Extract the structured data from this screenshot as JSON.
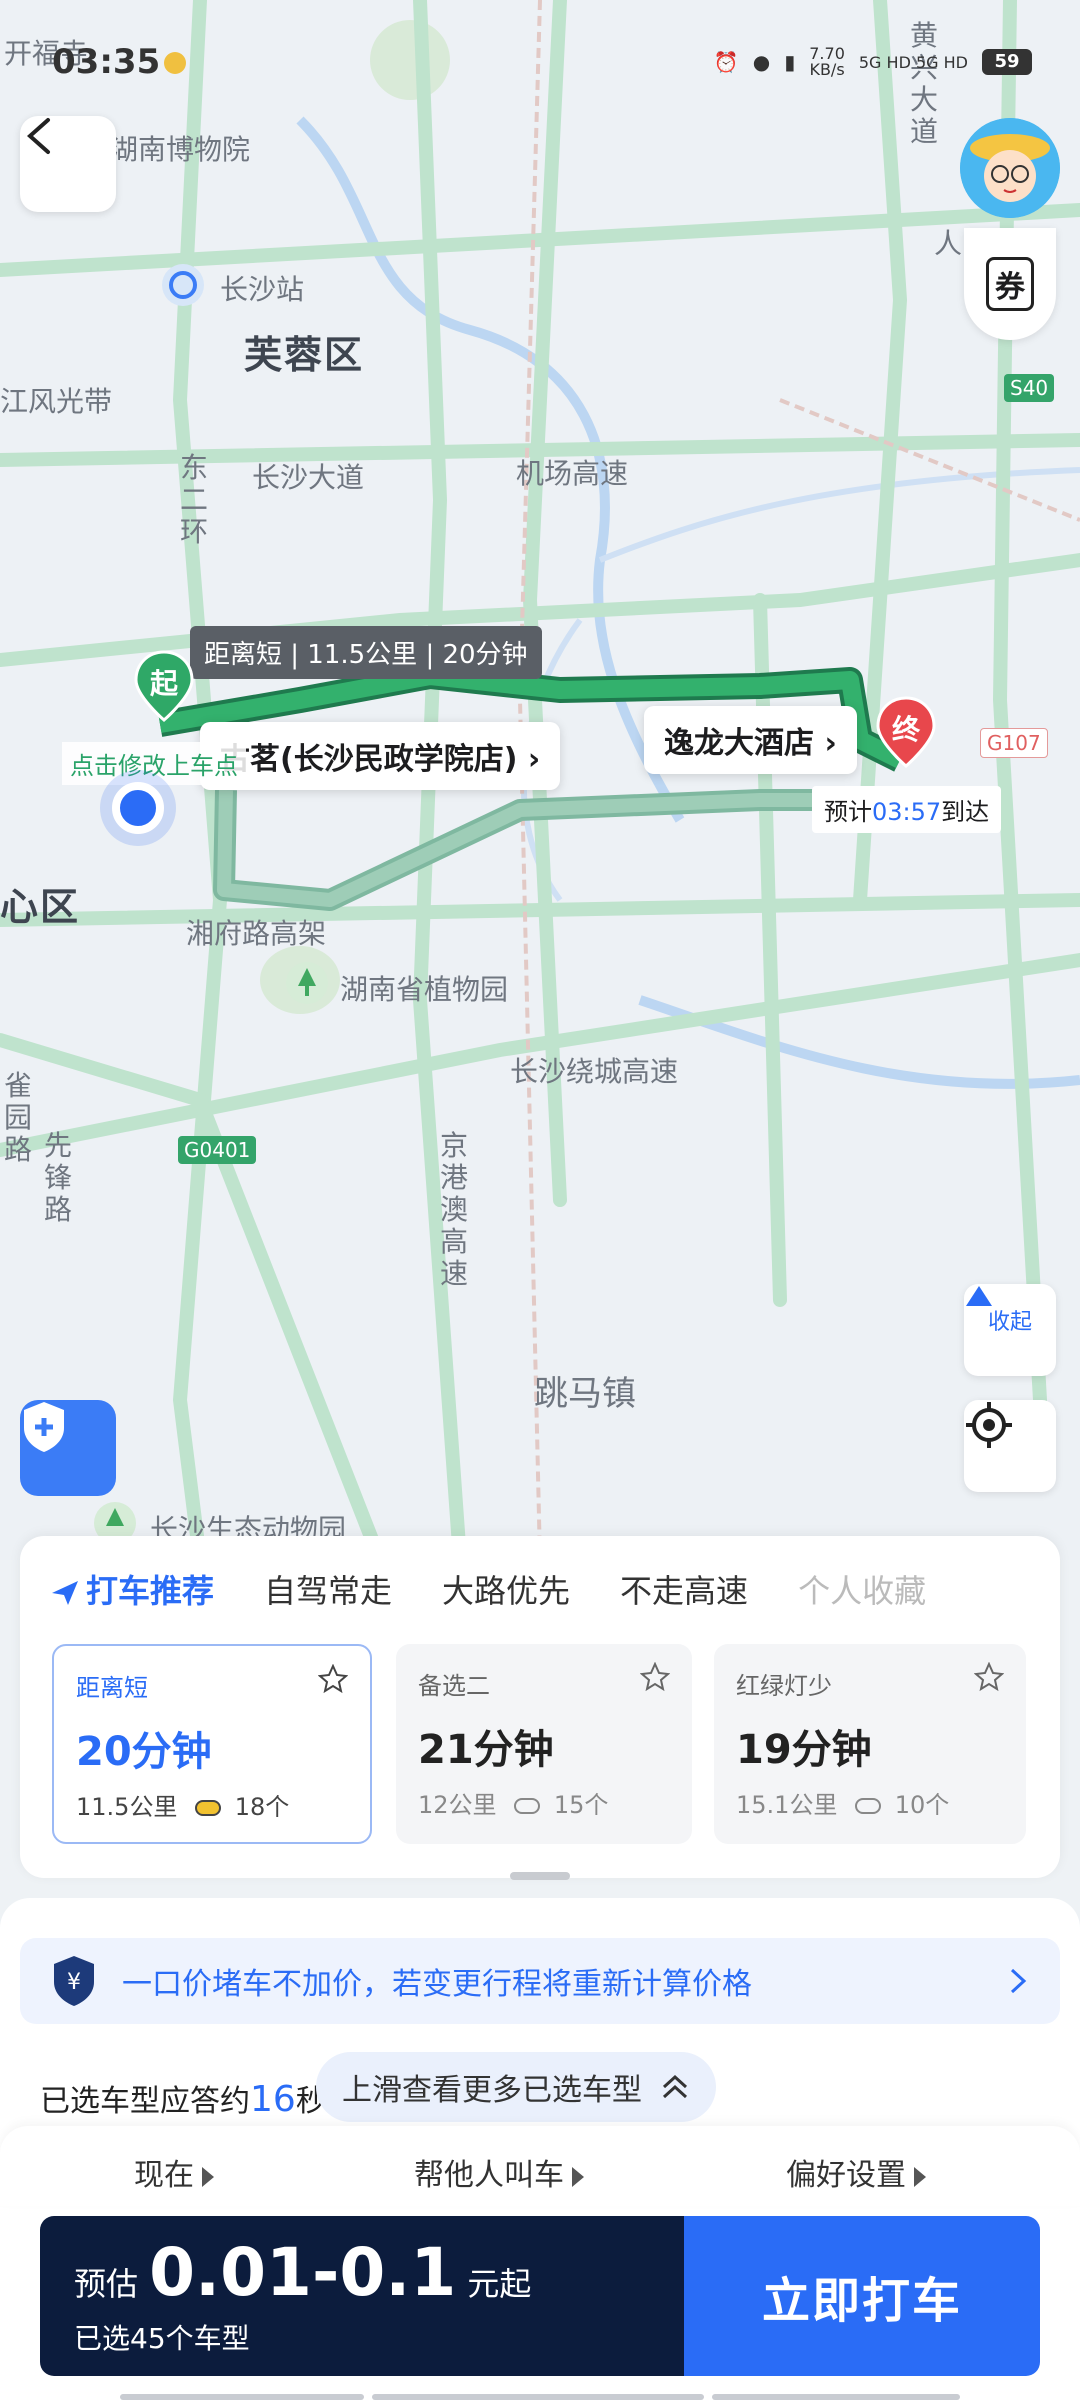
{
  "status_bar": {
    "time": "03:35",
    "net_speed": "7.70\nKB/s",
    "signal": "5G HD 5G HD",
    "battery": "59"
  },
  "map": {
    "labels": {
      "district_furong": "芙蓉区",
      "district_center": "心区",
      "station": "长沙站",
      "museum": "湖南博物院",
      "road_changsha_dadao": "长沙大道",
      "road_airport_hwy": "机场高速",
      "road_xiangfu": "湘府路高架",
      "road_ring": "长沙绕城高速",
      "road_jinggangao": "京港澳高速",
      "road_east2": "东二环",
      "road_queyuan": "雀园路",
      "road_xianfeng": "先锋路",
      "scenic": "江风光带",
      "botanic": "湖南省植物园",
      "town": "跳马镇",
      "zoo": "长沙生态动物园",
      "temple": "开福寺",
      "north": "黄兴大道",
      "north2": "人"
    },
    "shields": {
      "s40": "S40",
      "g107": "G107",
      "g0401": "G0401"
    },
    "route_tag": "距离短 | 11.5公里 | 20分钟",
    "start_pin": "起",
    "end_pin": "终",
    "start_place": "古茗(长沙民政学院店)",
    "end_place": "逸龙大酒店",
    "eta_prefix": "预计",
    "eta_time": "03:57",
    "eta_suffix": "到达",
    "modify_hint": "点击修改上车点",
    "collapse_label": "收起",
    "coupon_label": "券"
  },
  "route_panel": {
    "tabs": [
      {
        "label": "打车推荐"
      },
      {
        "label": "自驾常走"
      },
      {
        "label": "大路优先"
      },
      {
        "label": "不走高速"
      },
      {
        "label": "个人收藏"
      }
    ],
    "options": [
      {
        "name": "距离短",
        "time": "20分钟",
        "distance": "11.5公里",
        "lights": "18个",
        "selected": true
      },
      {
        "name": "备选二",
        "time": "21分钟",
        "distance": "12公里",
        "lights": "15个",
        "selected": false
      },
      {
        "name": "红绿灯少",
        "time": "19分钟",
        "distance": "15.1公里",
        "lights": "10个",
        "selected": false
      }
    ]
  },
  "sheet": {
    "notice": "一口价堵车不加价，若变更行程将重新计算价格",
    "response_prefix": "已选车型应答约",
    "response_num": "16",
    "response_suffix": "秒",
    "more_pill": "上滑查看更多已选车型",
    "options": {
      "now": "现在",
      "for_others": "帮他人叫车",
      "prefs": "偏好设置"
    },
    "price_label": "预估",
    "price_amount": "0.01-0.1",
    "price_unit": "元起",
    "selected_models": "已选45个车型",
    "cta": "立即打车"
  },
  "colors": {
    "accent": "#2a6cf6",
    "route_green": "#2fa867",
    "dark_navy": "#0c1c3d",
    "end_red": "#e8474c"
  }
}
